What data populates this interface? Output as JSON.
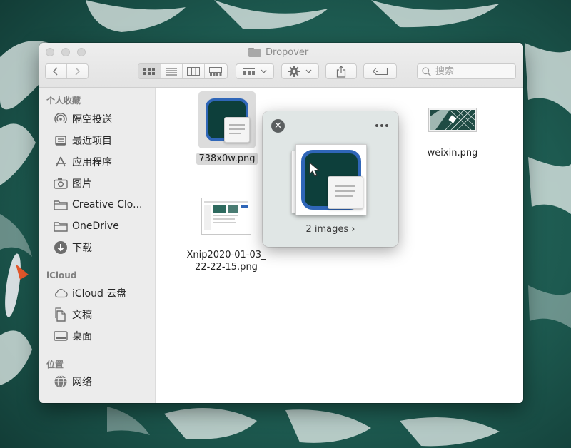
{
  "window": {
    "title": "Dropover",
    "folder_icon": "folder-icon"
  },
  "toolbar": {
    "back_icon": "chevron-left-icon",
    "forward_icon": "chevron-right-icon",
    "view_modes": [
      "icon-view-icon",
      "list-view-icon",
      "column-view-icon",
      "gallery-view-icon"
    ],
    "group_icon": "group-by-icon",
    "action_icon": "gear-icon",
    "share_icon": "share-icon",
    "tag_icon": "tag-icon",
    "search_placeholder": "搜索"
  },
  "sidebar": {
    "sections": [
      {
        "header": "个人收藏",
        "items": [
          {
            "label": "隔空投送",
            "icon": "airdrop-icon"
          },
          {
            "label": "最近项目",
            "icon": "recents-icon"
          },
          {
            "label": "应用程序",
            "icon": "applications-icon"
          },
          {
            "label": "图片",
            "icon": "camera-icon"
          },
          {
            "label": "Creative Clo...",
            "icon": "folder-icon"
          },
          {
            "label": "OneDrive",
            "icon": "folder-icon"
          },
          {
            "label": "下载",
            "icon": "download-icon"
          }
        ]
      },
      {
        "header": "iCloud",
        "items": [
          {
            "label": "iCloud 云盘",
            "icon": "cloud-icon"
          },
          {
            "label": "文稿",
            "icon": "document-icon"
          },
          {
            "label": "桌面",
            "icon": "desktop-icon"
          }
        ]
      },
      {
        "header": "位置",
        "items": [
          {
            "label": "网络",
            "icon": "globe-icon"
          }
        ]
      }
    ]
  },
  "files": [
    {
      "name": "738x0w.png",
      "selected": true
    },
    {
      "name": "weixin.png",
      "selected": false
    },
    {
      "name_line1": "Xnip2020-01-03_",
      "name_line2": "22-22-15.png",
      "selected": false
    }
  ],
  "popover": {
    "label": "2 images ›",
    "close_icon": "close-icon",
    "more_icon": "more-icon"
  },
  "colors": {
    "desktop": "#1c4f47",
    "app_icon_bg": "#0d3f3b",
    "app_icon_border": "#2f66b8",
    "selection": "#d8d8d8"
  }
}
